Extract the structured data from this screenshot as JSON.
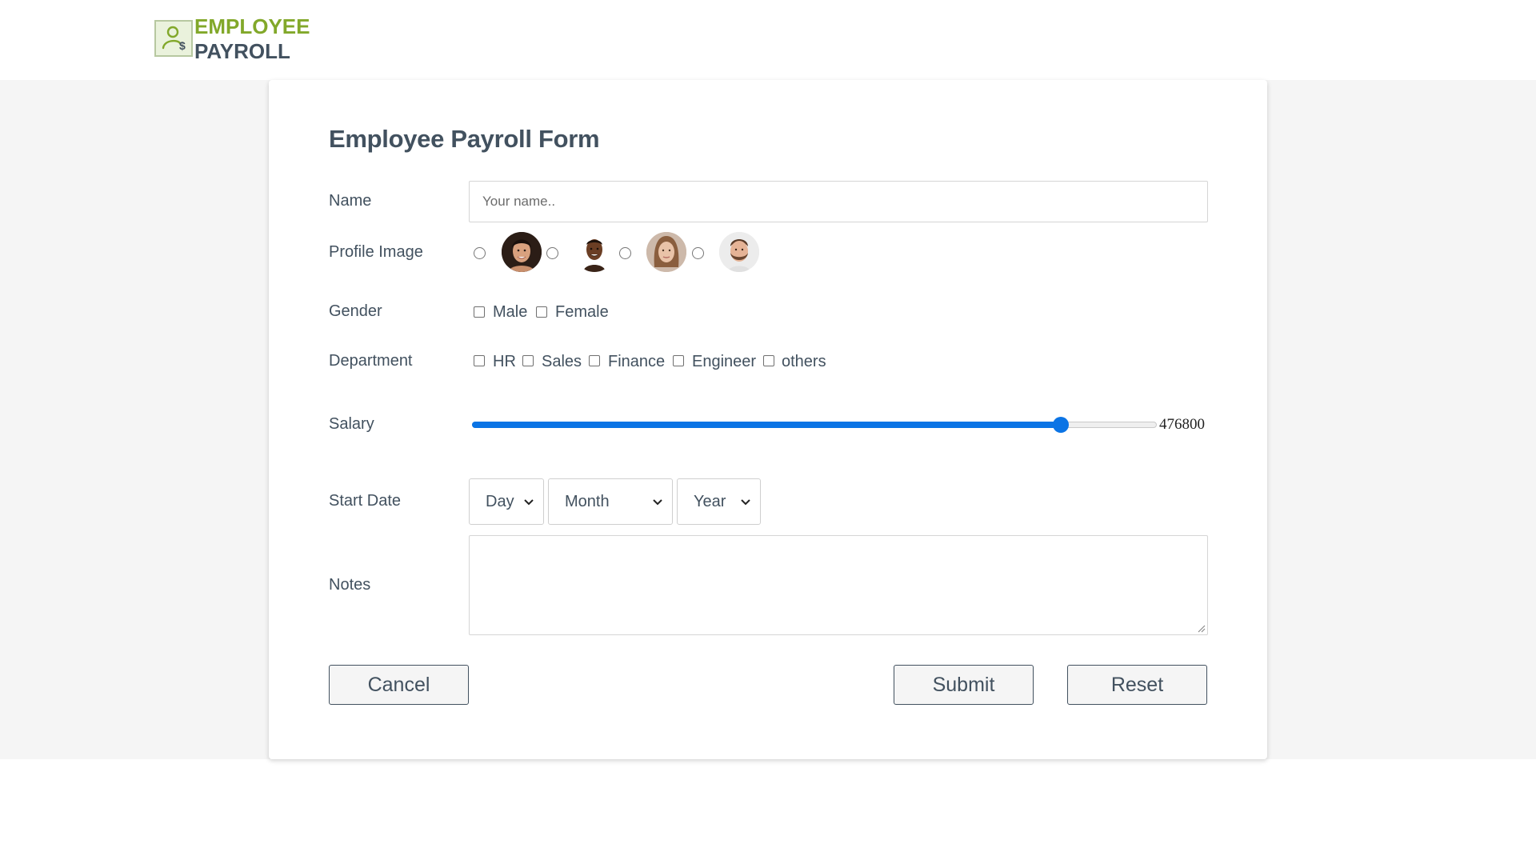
{
  "header": {
    "logo_line1": "EMPLOYEE",
    "logo_line2": "PAYROLL",
    "logo_icon": "employee-payroll-icon"
  },
  "form": {
    "title": "Employee Payroll Form",
    "name": {
      "label": "Name",
      "placeholder": "Your name..",
      "value": ""
    },
    "profile_image": {
      "label": "Profile Image",
      "options": [
        {
          "icon": "avatar-woman-dark-hair",
          "selected": false
        },
        {
          "icon": "avatar-man-dark-skin",
          "selected": false
        },
        {
          "icon": "avatar-woman-light-brown-hair",
          "selected": false
        },
        {
          "icon": "avatar-man-beard",
          "selected": false
        }
      ]
    },
    "gender": {
      "label": "Gender",
      "options": [
        {
          "label": "Male",
          "checked": false
        },
        {
          "label": "Female",
          "checked": false
        }
      ]
    },
    "department": {
      "label": "Department",
      "options": [
        {
          "label": "HR",
          "checked": false
        },
        {
          "label": "Sales",
          "checked": false
        },
        {
          "label": "Finance",
          "checked": false
        },
        {
          "label": "Engineer",
          "checked": false
        },
        {
          "label": "others",
          "checked": false
        }
      ]
    },
    "salary": {
      "label": "Salary",
      "value": "476800",
      "fill_fraction": 0.86,
      "accent": "#0b74e5"
    },
    "start_date": {
      "label": "Start Date",
      "day": "Day",
      "month": "Month",
      "year": "Year"
    },
    "notes": {
      "label": "Notes",
      "value": ""
    },
    "buttons": {
      "cancel": "Cancel",
      "submit": "Submit",
      "reset": "Reset"
    }
  },
  "colors": {
    "text": "#42515f",
    "brand_green": "#82a82a",
    "background_band": "#f5f5f5"
  }
}
